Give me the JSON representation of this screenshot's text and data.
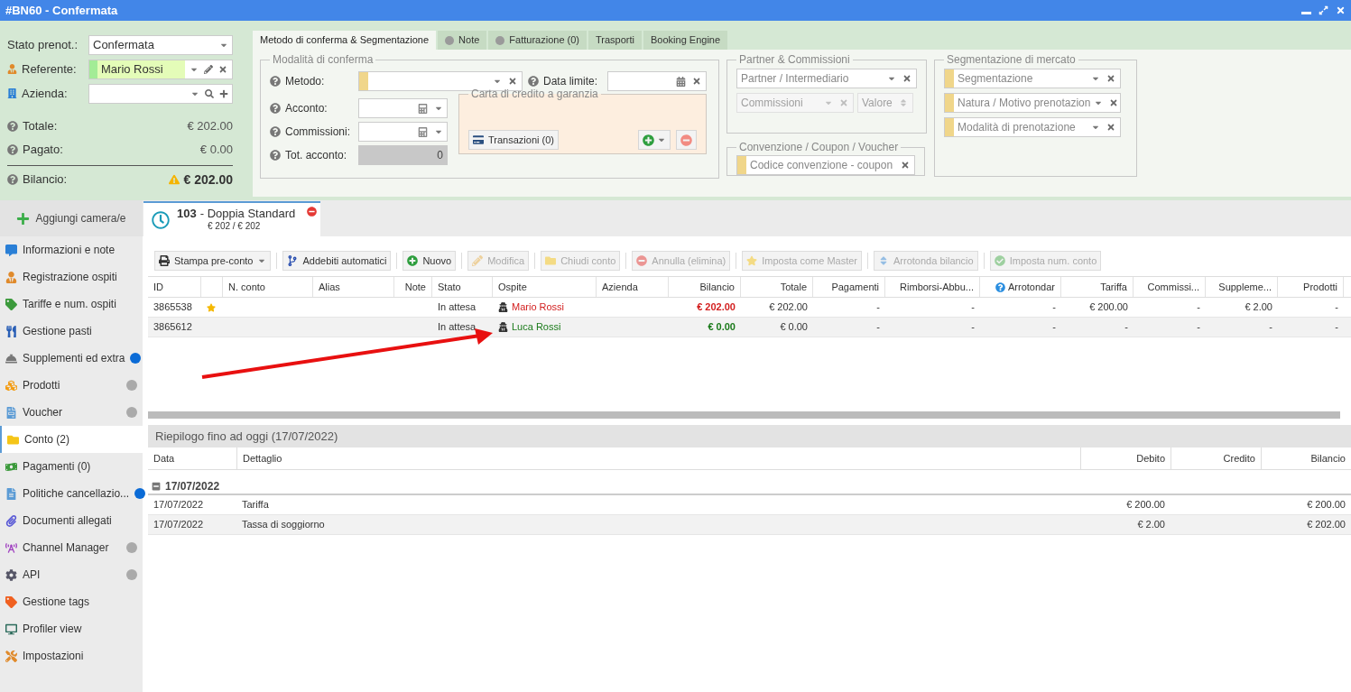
{
  "window": {
    "title": "#BN60 - Confermata"
  },
  "booking": {
    "fields": [
      {
        "label": "Stato prenot.:",
        "value": "Confermata",
        "kind": "select"
      },
      {
        "label": "Referente:",
        "value": "Mario Rossi",
        "kind": "contact"
      },
      {
        "label": "Azienda:",
        "kind": "company"
      }
    ],
    "totals": [
      {
        "label": "Totale:",
        "value": "€ 202.00"
      },
      {
        "label": "Pagato:",
        "value": "€ 0.00"
      }
    ],
    "balance": {
      "label": "Bilancio:",
      "value": "€ 202.00",
      "warning": true
    }
  },
  "tabs": [
    {
      "label": "Metodo di conferma & Segmentazione",
      "selected": true,
      "indicator": false
    },
    {
      "label": "Note",
      "selected": false,
      "indicator": true
    },
    {
      "label": "Fatturazione (0)",
      "selected": false,
      "indicator": true
    },
    {
      "label": "Trasporti",
      "selected": false,
      "indicator": false
    },
    {
      "label": "Booking Engine",
      "selected": false,
      "indicator": false
    }
  ],
  "confirmation": {
    "legend": "Modalità di conferma",
    "method_label": "Metodo:",
    "deadline_label": "Data limite:",
    "deposit_label": "Acconto:",
    "commission_label": "Commissioni:",
    "total_deposit_label": "Tot. acconto:",
    "total_deposit": "0",
    "card": {
      "legend": "Carta di credito a garanzia",
      "transactions": "Transazioni (0)"
    }
  },
  "partner": {
    "legend": "Partner & Commissioni",
    "fields": [
      {
        "placeholder": "Partner / Intermediario",
        "disabled": false
      },
      {
        "placeholder": "Commissioni",
        "disabled": true
      },
      {
        "placeholder": "Valore",
        "disabled": true
      }
    ]
  },
  "agreement": {
    "legend": "Convenzione / Coupon / Voucher",
    "placeholder": "Codice convenzione - coupon"
  },
  "segmentation": {
    "legend": "Segmentazione di mercato",
    "placeholders": [
      "Segmentazione",
      "Natura / Motivo prenotazion",
      "Modalità di prenotazione"
    ]
  },
  "sidebar": {
    "add_button": "Aggiungi camera/e",
    "items": [
      {
        "label": "Informazioni e note",
        "selected": false
      },
      {
        "label": "Registrazione ospiti",
        "selected": false
      },
      {
        "label": "Tariffe e num. ospiti",
        "selected": false
      },
      {
        "label": "Gestione pasti",
        "selected": false
      },
      {
        "label": "Supplementi ed extra",
        "selected": false,
        "color": "#0b6bd6"
      },
      {
        "label": "Prodotti",
        "selected": false,
        "color": "#aaaaaa"
      },
      {
        "label": "Voucher",
        "selected": false,
        "color": "#aaaaaa"
      },
      {
        "label": "Conto (2)",
        "selected": true
      },
      {
        "label": "Pagamenti (0)",
        "selected": false
      },
      {
        "label": "Politiche cancellazio...",
        "selected": false,
        "color": "#0b6bd6"
      },
      {
        "label": "Documenti allegati",
        "selected": false
      },
      {
        "label": "Channel Manager",
        "selected": false,
        "color": "#aaaaaa"
      },
      {
        "label": "API",
        "selected": false,
        "color": "#aaaaaa"
      },
      {
        "label": "Gestione tags",
        "selected": false
      },
      {
        "label": "Profiler view",
        "selected": false
      },
      {
        "label": "Impostazioni",
        "selected": false
      }
    ]
  },
  "room_tab": {
    "number": "103",
    "title": "- Doppia Standard",
    "amount": "€ 202 / € 202"
  },
  "toolbar": [
    {
      "label": "Stampa pre-conto",
      "disabled": false
    },
    {
      "label": "Addebiti automatici",
      "disabled": false
    },
    {
      "label": "Nuovo",
      "disabled": false
    },
    {
      "label": "Modifica",
      "disabled": true
    },
    {
      "label": "Chiudi conto",
      "disabled": true
    },
    {
      "label": "Annulla (elimina)",
      "disabled": true
    },
    {
      "label": "Imposta come Master",
      "disabled": true
    },
    {
      "label": "Arrotonda bilancio",
      "disabled": true
    },
    {
      "label": "Imposta num. conto",
      "disabled": true
    }
  ],
  "accounts": {
    "columns": [
      {
        "label": "ID",
        "help": false
      },
      {
        "help": false
      },
      {
        "label": "N. conto",
        "help": false
      },
      {
        "label": "Alias",
        "help": false
      },
      {
        "label": "Note",
        "help": false
      },
      {
        "label": "Stato",
        "help": false
      },
      {
        "label": "Ospite",
        "help": false
      },
      {
        "label": "Azienda",
        "help": false
      },
      {
        "label": "Bilancio",
        "help": false
      },
      {
        "label": "Totale",
        "help": false
      },
      {
        "label": "Pagamenti",
        "help": false
      },
      {
        "label": "Rimborsi-Abbu...",
        "help": false
      },
      {
        "label": "Arrotondar",
        "help": true
      },
      {
        "label": "Tariffa",
        "help": false
      },
      {
        "label": "Commissi...",
        "help": false
      },
      {
        "label": "Suppleme...",
        "help": false
      },
      {
        "label": "Prodotti",
        "help": false
      }
    ],
    "rows": [
      {
        "id": "3865538",
        "master": true,
        "stato": "In attesa",
        "ospite": "Mario Rossi",
        "color": "#d32020",
        "bilancio": "€ 202.00",
        "totale": "€ 202.00",
        "pagamenti": "-",
        "rimborsi": "-",
        "arrotondamento": "-",
        "tariffa": "€ 200.00",
        "commissioni": "-",
        "supplementi": "€ 2.00",
        "prodotti": "-"
      },
      {
        "id": "3865612",
        "master": false,
        "stato": "In attesa",
        "ospite": "Luca Rossi",
        "color": "#1a7a1a",
        "bilancio": "€ 0.00",
        "totale": "€ 0.00",
        "pagamenti": "-",
        "rimborsi": "-",
        "arrotondamento": "-",
        "tariffa": "-",
        "commissioni": "-",
        "supplementi": "-",
        "prodotti": "-"
      }
    ]
  },
  "summary": {
    "title": "Riepilogo fino ad oggi (17/07/2022)",
    "columns": [
      "Data",
      "Dettaglio",
      "Debito",
      "Credito",
      "Bilancio"
    ],
    "groups": [
      {
        "label": "17/07/2022",
        "expanded": true,
        "rows": [
          {
            "data": "17/07/2022",
            "dettaglio": "Tariffa",
            "debito": "€ 200.00",
            "bilancio": "€ 200.00"
          },
          {
            "data": "17/07/2022",
            "dettaglio": "Tassa di soggiorno",
            "debito": "€ 2.00",
            "bilancio": "€ 202.00"
          }
        ]
      }
    ]
  }
}
